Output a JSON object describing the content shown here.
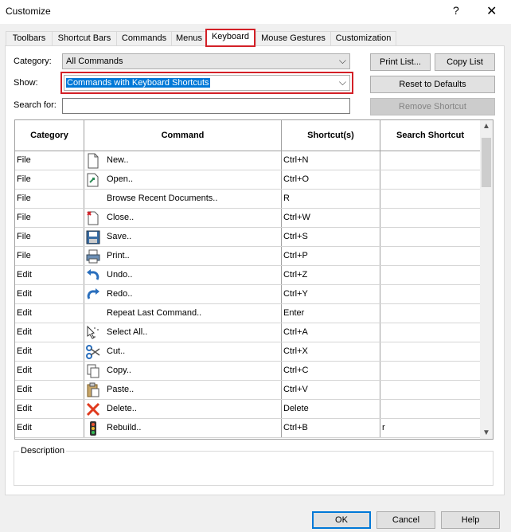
{
  "window": {
    "title": "Customize",
    "help_glyph": "?",
    "close_glyph": "✕"
  },
  "tabs": [
    "Toolbars",
    "Shortcut Bars",
    "Commands",
    "Menus",
    "Keyboard",
    "Mouse Gestures",
    "Customization"
  ],
  "active_tab": "Keyboard",
  "form": {
    "category_label": "Category:",
    "category_value": "All Commands",
    "show_label": "Show:",
    "show_value": "Commands with Keyboard Shortcuts",
    "search_label": "Search for:",
    "search_value": ""
  },
  "buttons": {
    "print_list": "Print List...",
    "copy_list": "Copy List",
    "reset_defaults": "Reset to Defaults",
    "remove_shortcut": "Remove Shortcut",
    "ok": "OK",
    "cancel": "Cancel",
    "help": "Help"
  },
  "table": {
    "headers": [
      "Category",
      "Command",
      "Shortcut(s)",
      "Search Shortcut"
    ],
    "rows": [
      {
        "category": "File",
        "command": "New..",
        "shortcut": "Ctrl+N",
        "search": "",
        "icon": "new-document-icon"
      },
      {
        "category": "File",
        "command": "Open..",
        "shortcut": "Ctrl+O",
        "search": "",
        "icon": "open-document-icon"
      },
      {
        "category": "File",
        "command": "Browse Recent Documents..",
        "shortcut": "R",
        "search": "",
        "icon": ""
      },
      {
        "category": "File",
        "command": "Close..",
        "shortcut": "Ctrl+W",
        "search": "",
        "icon": "close-document-icon"
      },
      {
        "category": "File",
        "command": "Save..",
        "shortcut": "Ctrl+S",
        "search": "",
        "icon": "save-disk-icon"
      },
      {
        "category": "File",
        "command": "Print..",
        "shortcut": "Ctrl+P",
        "search": "",
        "icon": "printer-icon"
      },
      {
        "category": "Edit",
        "command": "Undo..",
        "shortcut": "Ctrl+Z",
        "search": "",
        "icon": "undo-arrow-icon"
      },
      {
        "category": "Edit",
        "command": "Redo..",
        "shortcut": "Ctrl+Y",
        "search": "",
        "icon": "redo-arrow-icon"
      },
      {
        "category": "Edit",
        "command": "Repeat Last Command..",
        "shortcut": "Enter",
        "search": "",
        "icon": ""
      },
      {
        "category": "Edit",
        "command": "Select All..",
        "shortcut": "Ctrl+A",
        "search": "",
        "icon": "select-all-icon"
      },
      {
        "category": "Edit",
        "command": "Cut..",
        "shortcut": "Ctrl+X",
        "search": "",
        "icon": "scissors-icon"
      },
      {
        "category": "Edit",
        "command": "Copy..",
        "shortcut": "Ctrl+C",
        "search": "",
        "icon": "copy-icon"
      },
      {
        "category": "Edit",
        "command": "Paste..",
        "shortcut": "Ctrl+V",
        "search": "",
        "icon": "paste-clipboard-icon"
      },
      {
        "category": "Edit",
        "command": "Delete..",
        "shortcut": "Delete",
        "search": "",
        "icon": "delete-x-icon"
      },
      {
        "category": "Edit",
        "command": "Rebuild..",
        "shortcut": "Ctrl+B",
        "search": "r",
        "icon": "traffic-light-icon"
      }
    ]
  },
  "description": {
    "label": "Description",
    "text": ""
  },
  "colors": {
    "highlight_border": "#d32027",
    "selection": "#0078d7"
  }
}
